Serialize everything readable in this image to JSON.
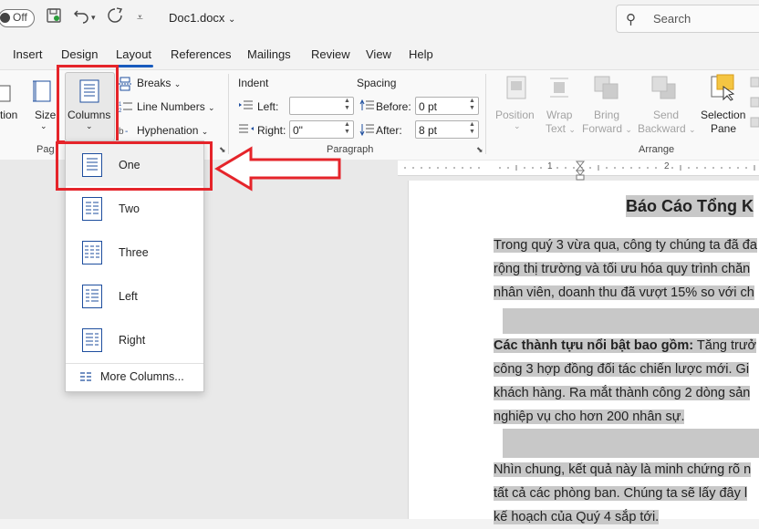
{
  "titlebar": {
    "autosave_label": "Off",
    "document_name": "Doc1.docx",
    "search_placeholder": "Search"
  },
  "tabs": [
    "Insert",
    "Design",
    "Layout",
    "References",
    "Mailings",
    "Review",
    "View",
    "Help"
  ],
  "active_tab": "Layout",
  "ribbon": {
    "page_setup": {
      "partial_left_label": "tion",
      "size_label": "Size",
      "columns_label": "Columns",
      "breaks_label": "Breaks",
      "line_numbers_label": "Line Numbers",
      "hyphenation_label": "Hyphenation",
      "group_label_partial": "Pag"
    },
    "paragraph": {
      "indent_title": "Indent",
      "left_label": "Left:",
      "left_value": "",
      "right_label": "Right:",
      "right_value": "0\"",
      "spacing_title": "Spacing",
      "before_label": "Before:",
      "before_value": "0 pt",
      "after_label": "After:",
      "after_value": "8 pt",
      "group_label": "Paragraph"
    },
    "arrange": {
      "position_label": "Position",
      "wrap_text_label1": "Wrap",
      "wrap_text_label2": "Text",
      "bring_forward_label1": "Bring",
      "bring_forward_label2": "Forward",
      "send_backward_label1": "Send",
      "send_backward_label2": "Backward",
      "selection_pane_label1": "Selection",
      "selection_pane_label2": "Pane",
      "group_label": "Arrange"
    }
  },
  "columns_menu": {
    "items": [
      "One",
      "Two",
      "Three",
      "Left",
      "Right"
    ],
    "more_label": "More Columns..."
  },
  "ruler": {
    "marks": [
      "1",
      "2"
    ]
  },
  "document": {
    "title": "Báo Cáo Tổng K",
    "para1": [
      "Trong quý 3 vừa qua, công ty chúng ta đã đa",
      "rộng thị trường và tối ưu hóa quy trình chăn",
      "nhân viên, doanh thu đã vượt 15% so với ch"
    ],
    "para2_bold": "Các thành tựu nổi bật bao gồm:",
    "para2_first_rest": " Tăng trưở",
    "para2": [
      "công 3 hợp đồng đối tác chiến lược mới. Gi",
      "khách hàng. Ra mắt thành công 2 dòng sản",
      "nghiệp vụ cho hơn 200 nhân sự."
    ],
    "para3": [
      "Nhìn chung, kết quả này là minh chứng rõ n",
      "tất cả các phòng ban. Chúng ta sẽ lấy đây l",
      "kế hoạch của Quý 4 sắp tới."
    ]
  },
  "colors": {
    "highlight_red": "#e5242a",
    "accent_blue": "#185abd",
    "text_highlight": "#c8c8c8"
  }
}
